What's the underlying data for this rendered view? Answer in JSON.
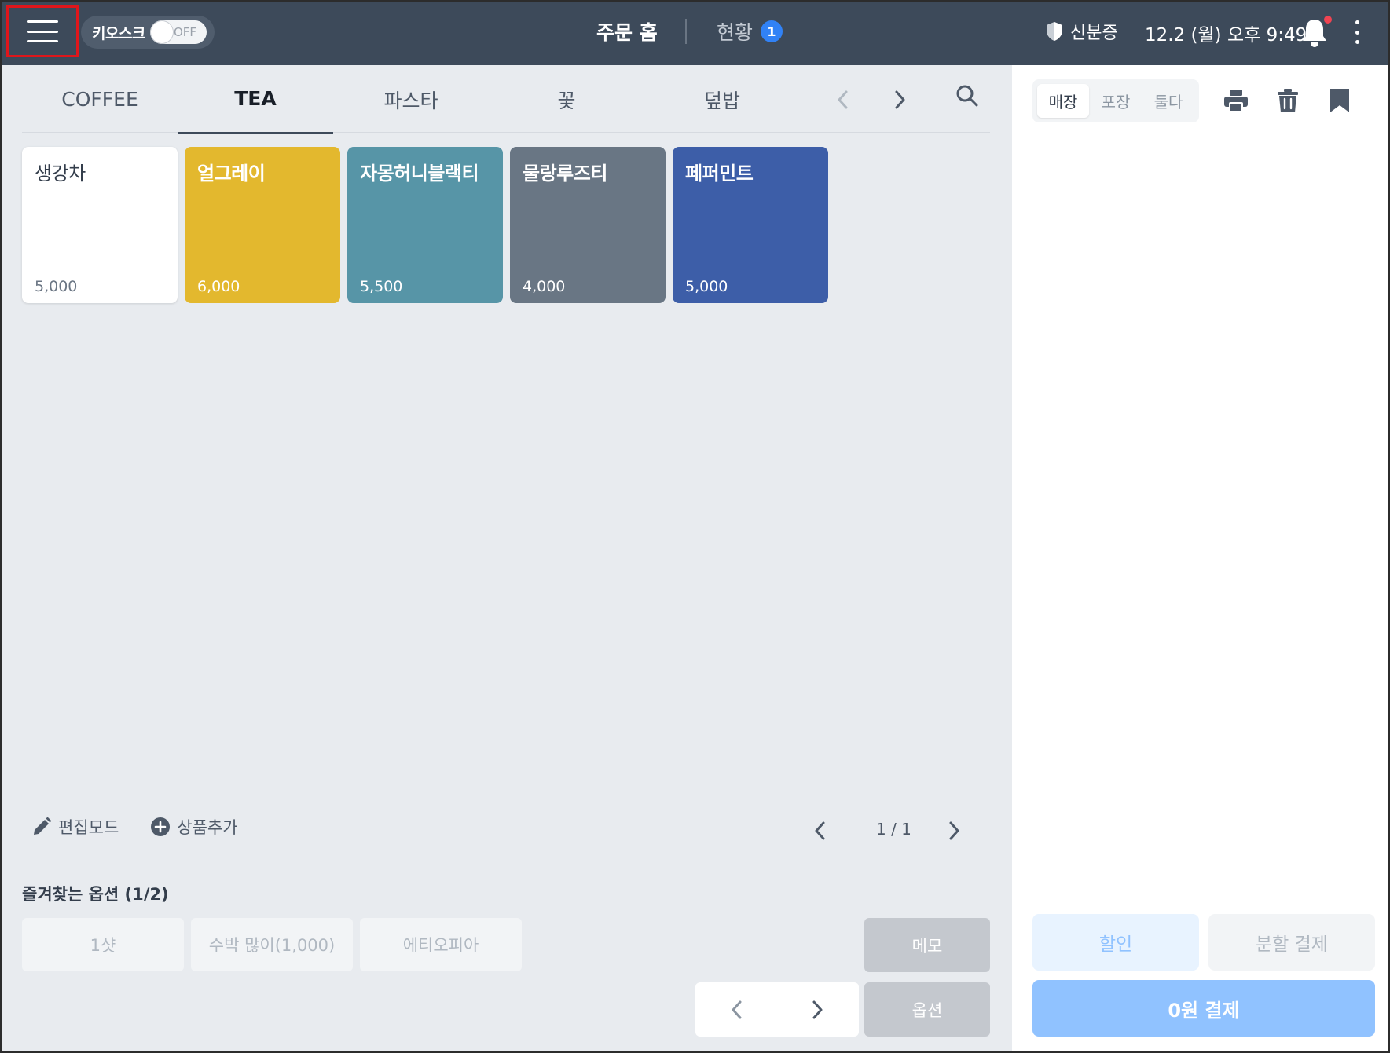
{
  "header": {
    "kiosk_label": "키오스크",
    "kiosk_toggle": "OFF",
    "nav_home": "주문 홈",
    "nav_status": "현황",
    "status_badge": "1",
    "id_card": "신분증",
    "datetime": "12.2 (월) 오후 9:49"
  },
  "categories": {
    "tabs": [
      {
        "label": "COFFEE"
      },
      {
        "label": "TEA"
      },
      {
        "label": "파스타"
      },
      {
        "label": "꽃"
      },
      {
        "label": "덮밥"
      }
    ],
    "active": "TEA"
  },
  "products": [
    {
      "name": "생강차",
      "price": "5,000",
      "color": "#ffffff"
    },
    {
      "name": "얼그레이",
      "price": "6,000",
      "color": "#e3b82e"
    },
    {
      "name": "자몽허니블랙티",
      "price": "5,500",
      "color": "#5795a7"
    },
    {
      "name": "물랑루즈티",
      "price": "4,000",
      "color": "#697684"
    },
    {
      "name": "페퍼민트",
      "price": "5,000",
      "color": "#3d5ea8"
    }
  ],
  "tools": {
    "edit_mode": "편집모드",
    "add_product": "상품추가",
    "page": "1 / 1"
  },
  "favorites": {
    "title": "즐겨찾는 옵션 (1/2)",
    "options": [
      "1샷",
      "수박 많이(1,000)",
      "에티오피아"
    ],
    "memo": "메모",
    "option": "옵션"
  },
  "order_panel": {
    "modes": [
      "매장",
      "포장",
      "둘다"
    ],
    "active_mode": "매장",
    "discount": "할인",
    "split_pay": "분할 결제",
    "pay": "0원 결제"
  },
  "colors": {
    "topbar": "#3d4a5a",
    "accent": "#3182f6",
    "pay_button": "#90c2ff"
  }
}
